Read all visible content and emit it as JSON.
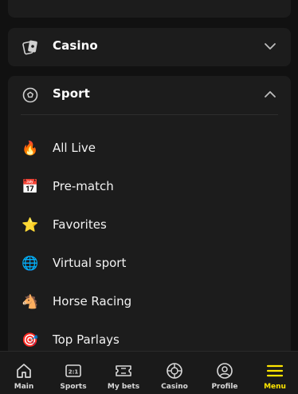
{
  "sections": {
    "casino": {
      "label": "Casino",
      "icon": "cards-icon",
      "expanded": false
    },
    "sport": {
      "label": "Sport",
      "icon": "soccer-ball-icon",
      "expanded": true,
      "items": [
        {
          "label": "All Live",
          "icon": "fire-icon",
          "glyph": "🔥"
        },
        {
          "label": "Pre-match",
          "icon": "calendar-icon",
          "glyph": "📅"
        },
        {
          "label": "Favorites",
          "icon": "star-icon",
          "glyph": "⭐"
        },
        {
          "label": "Virtual sport",
          "icon": "globe-icon",
          "glyph": "🌐"
        },
        {
          "label": "Horse Racing",
          "icon": "horse-icon",
          "glyph": "🐴"
        },
        {
          "label": "Top Parlays",
          "icon": "target-icon",
          "glyph": "🎯"
        }
      ]
    }
  },
  "bottom_nav": [
    {
      "label": "Main",
      "icon": "home-icon"
    },
    {
      "label": "Sports",
      "icon": "scoreboard-icon",
      "badge": "2:1"
    },
    {
      "label": "My bets",
      "icon": "ticket-icon"
    },
    {
      "label": "Casino",
      "icon": "roulette-icon"
    },
    {
      "label": "Profile",
      "icon": "user-icon"
    },
    {
      "label": "Menu",
      "icon": "menu-icon",
      "active": true
    }
  ],
  "colors": {
    "accent": "#ffe600",
    "panel": "#1c1c1c",
    "background": "#111111"
  }
}
